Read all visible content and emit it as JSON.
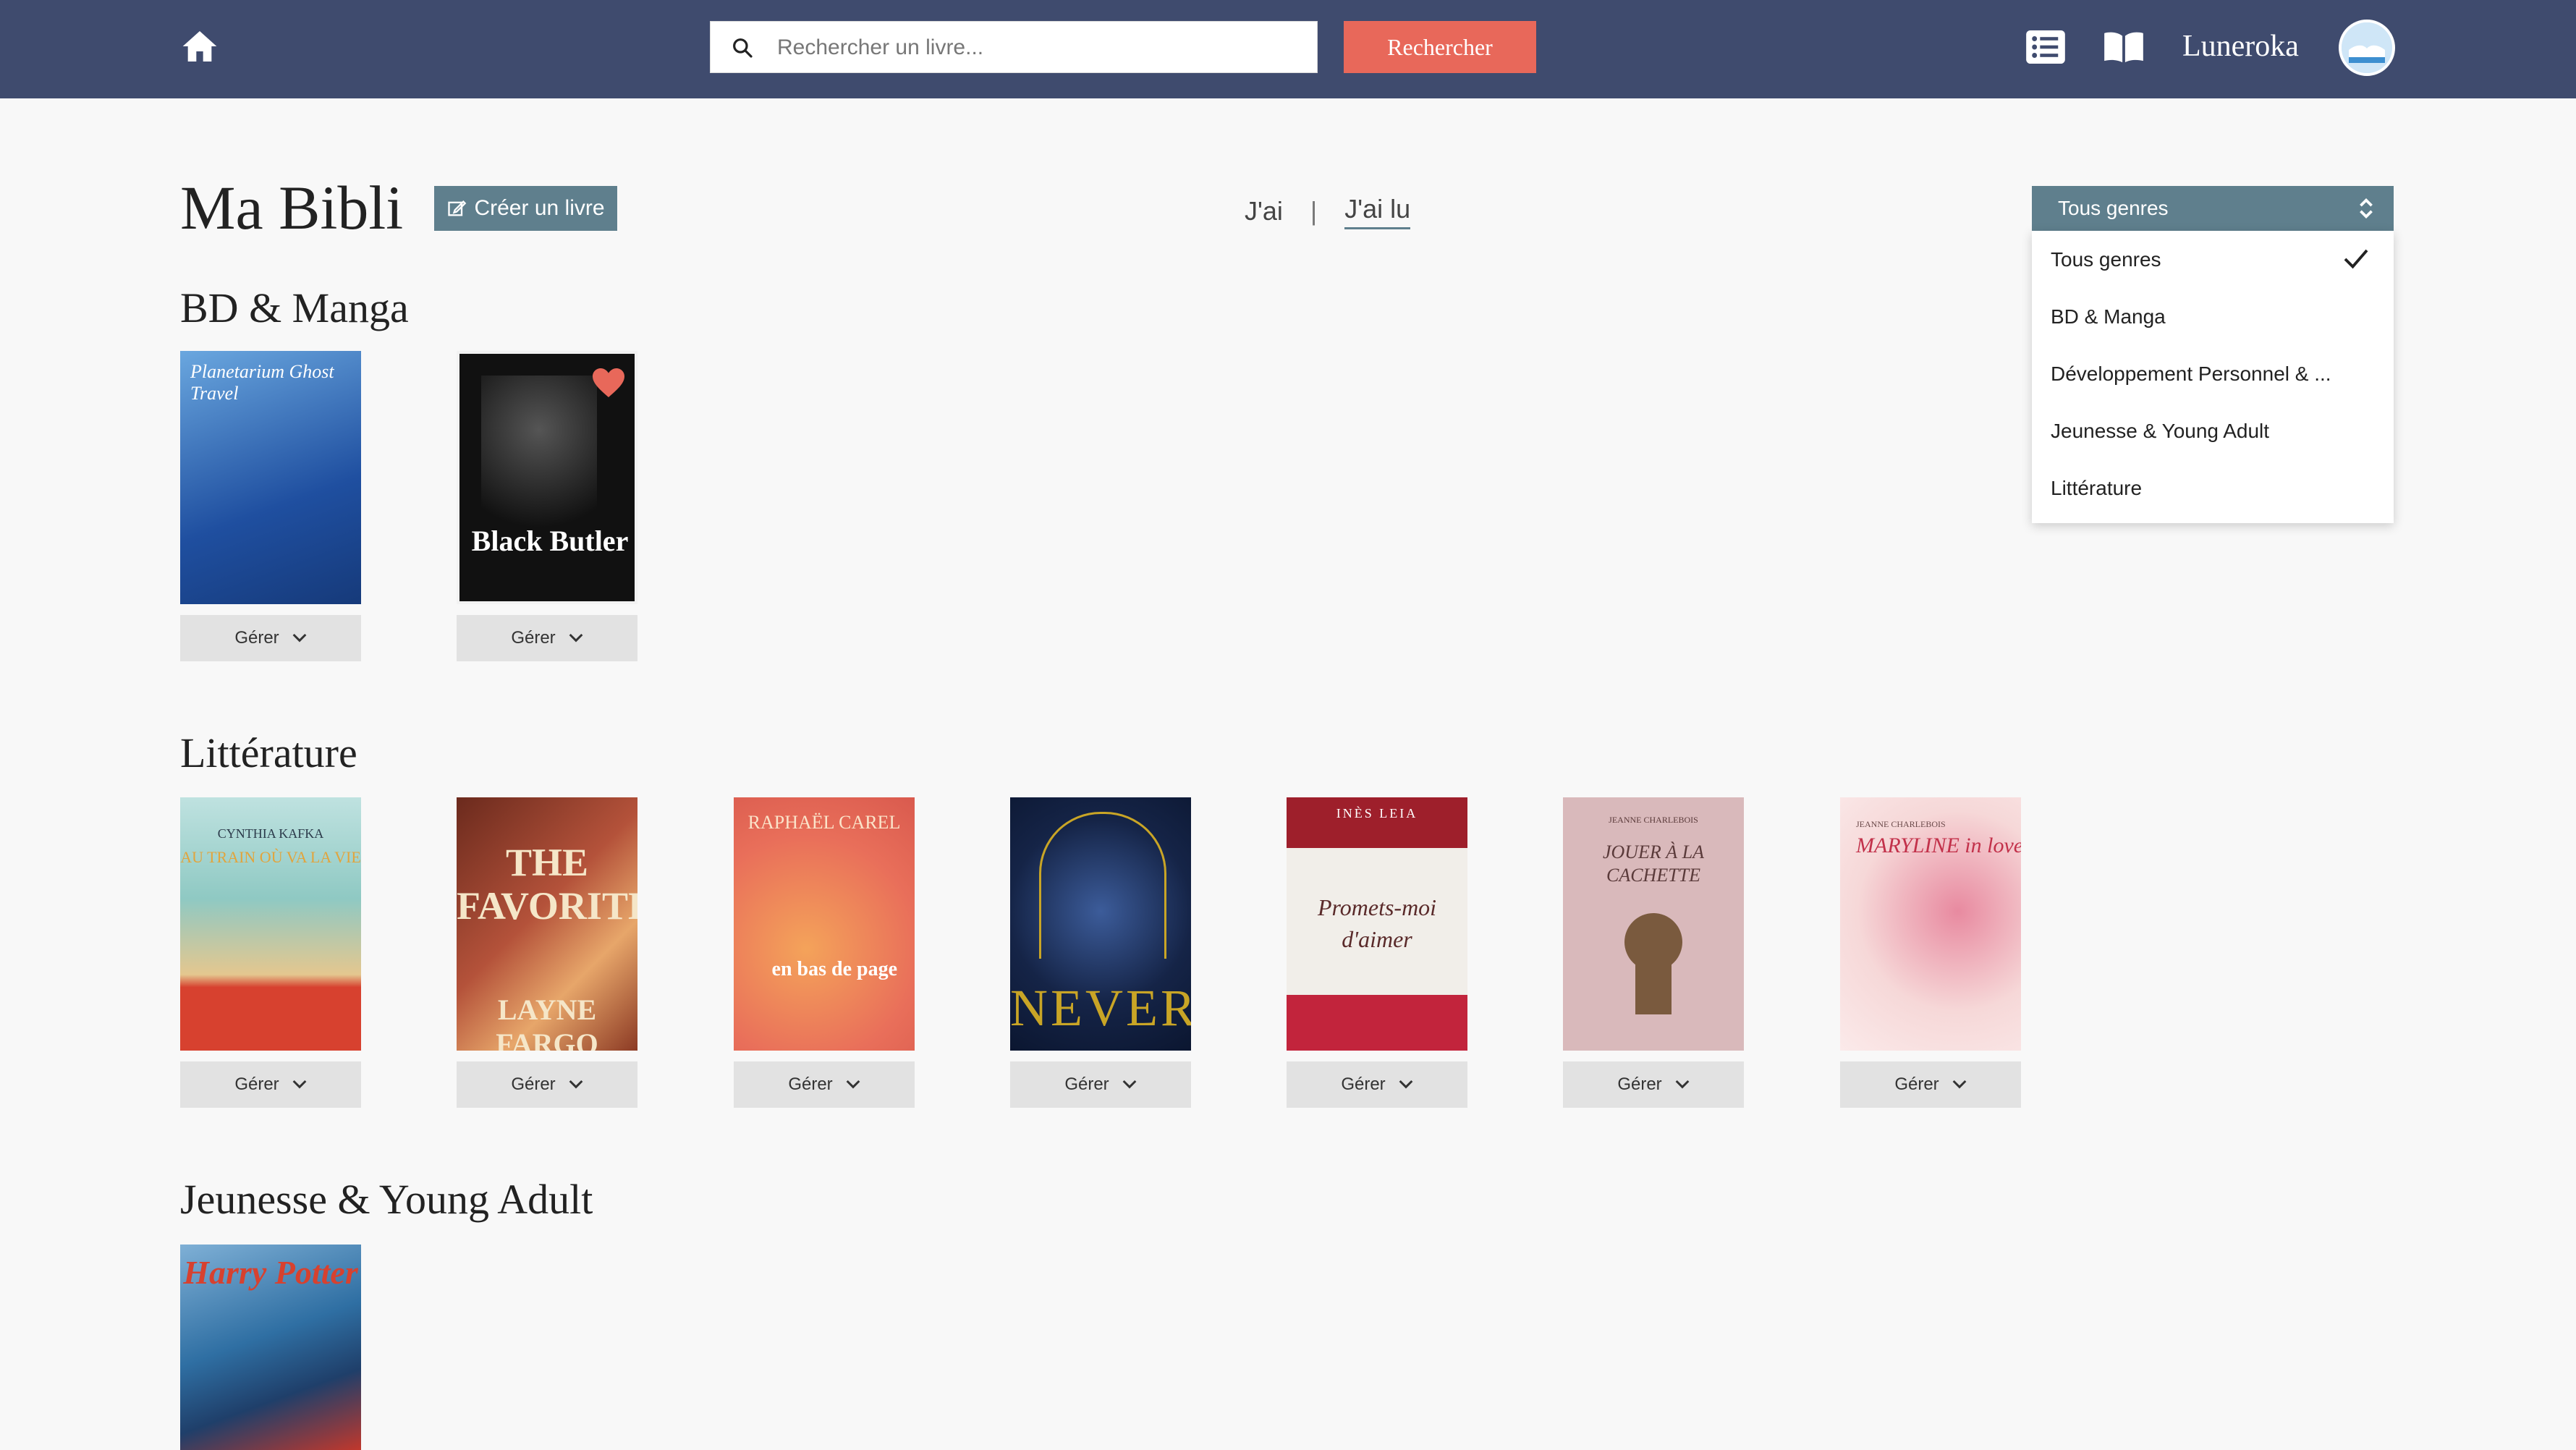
{
  "header": {
    "search_placeholder": "Rechercher un livre...",
    "search_button": "Rechercher",
    "username": "Luneroka"
  },
  "page": {
    "title": "Ma Bibli",
    "create_button": "Créer un livre",
    "toggle": {
      "owned": "J'ai",
      "separator": "|",
      "read": "J'ai lu",
      "active": "read"
    }
  },
  "genre_filter": {
    "selected": "Tous genres",
    "options": [
      "Tous genres",
      "BD & Manga",
      "Développement Personnel & ...",
      "Jeunesse & Young Adult",
      "Littérature"
    ]
  },
  "manage_label": "Gérer",
  "sections": [
    {
      "title": "BD & Manga",
      "books": [
        {
          "cover_text": "Planetarium Ghost Travel",
          "colors": [
            "#1f4fa0",
            "#6aa7df"
          ],
          "favorite": false
        },
        {
          "cover_text": "Black Butler",
          "colors": [
            "#f2f2f2",
            "#1a1a1a"
          ],
          "favorite": true
        }
      ]
    },
    {
      "title": "Littérature",
      "books": [
        {
          "cover_text": "AU TRAIN OÙ VA LA VIE",
          "author": "CYNTHIA KAFKA",
          "colors": [
            "#8fc9c3",
            "#d7412f"
          ],
          "favorite": false
        },
        {
          "cover_text": "THE FAVORITES",
          "author": "LAYNE FARGO",
          "colors": [
            "#b4523a",
            "#e7a66a"
          ],
          "favorite": false
        },
        {
          "cover_text": "en bas de page",
          "author": "RAPHAËL CAREL",
          "colors": [
            "#e96f5a",
            "#f4a35a"
          ],
          "favorite": false
        },
        {
          "cover_text": "NEVER",
          "colors": [
            "#152447",
            "#c9a526"
          ],
          "favorite": false
        },
        {
          "cover_text": "Promets-moi d'aimer",
          "author": "INÈS LEIA",
          "colors": [
            "#9e1f2b",
            "#f1eee9"
          ],
          "favorite": false
        },
        {
          "cover_text": "JOUER À LA CACHETTE",
          "author": "JEANNE CHARLEBOIS",
          "colors": [
            "#d9b9bb",
            "#7a5a3e"
          ],
          "favorite": false
        },
        {
          "cover_text": "MARYLINE in love",
          "author": "JEANNE CHARLEBOIS",
          "colors": [
            "#f6d8d8",
            "#c2314a"
          ],
          "favorite": false
        }
      ]
    },
    {
      "title": "Jeunesse & Young Adult",
      "books": [
        {
          "cover_text": "Harry Potter",
          "colors": [
            "#2f6fa3",
            "#c1382c"
          ],
          "favorite": false
        }
      ]
    }
  ]
}
